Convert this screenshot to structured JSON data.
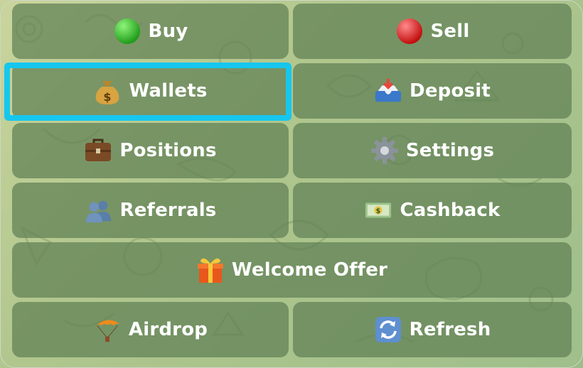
{
  "menu": {
    "buy": {
      "label": "Buy",
      "icon": "green-circle-icon"
    },
    "sell": {
      "label": "Sell",
      "icon": "red-circle-icon"
    },
    "wallets": {
      "label": "Wallets",
      "icon": "money-bag-icon"
    },
    "deposit": {
      "label": "Deposit",
      "icon": "inbox-tray-icon"
    },
    "positions": {
      "label": "Positions",
      "icon": "briefcase-icon"
    },
    "settings": {
      "label": "Settings",
      "icon": "gear-icon"
    },
    "referrals": {
      "label": "Referrals",
      "icon": "busts-icon"
    },
    "cashback": {
      "label": "Cashback",
      "icon": "dollar-banknote-icon"
    },
    "welcome_offer": {
      "label": "Welcome Offer",
      "icon": "gift-icon"
    },
    "airdrop": {
      "label": "Airdrop",
      "icon": "parachute-icon"
    },
    "refresh": {
      "label": "Refresh",
      "icon": "refresh-arrows-icon"
    }
  },
  "colors": {
    "button_bg": "rgba(96,128,84,0.72)",
    "highlight": "#17c6ee",
    "text": "#ffffff"
  }
}
